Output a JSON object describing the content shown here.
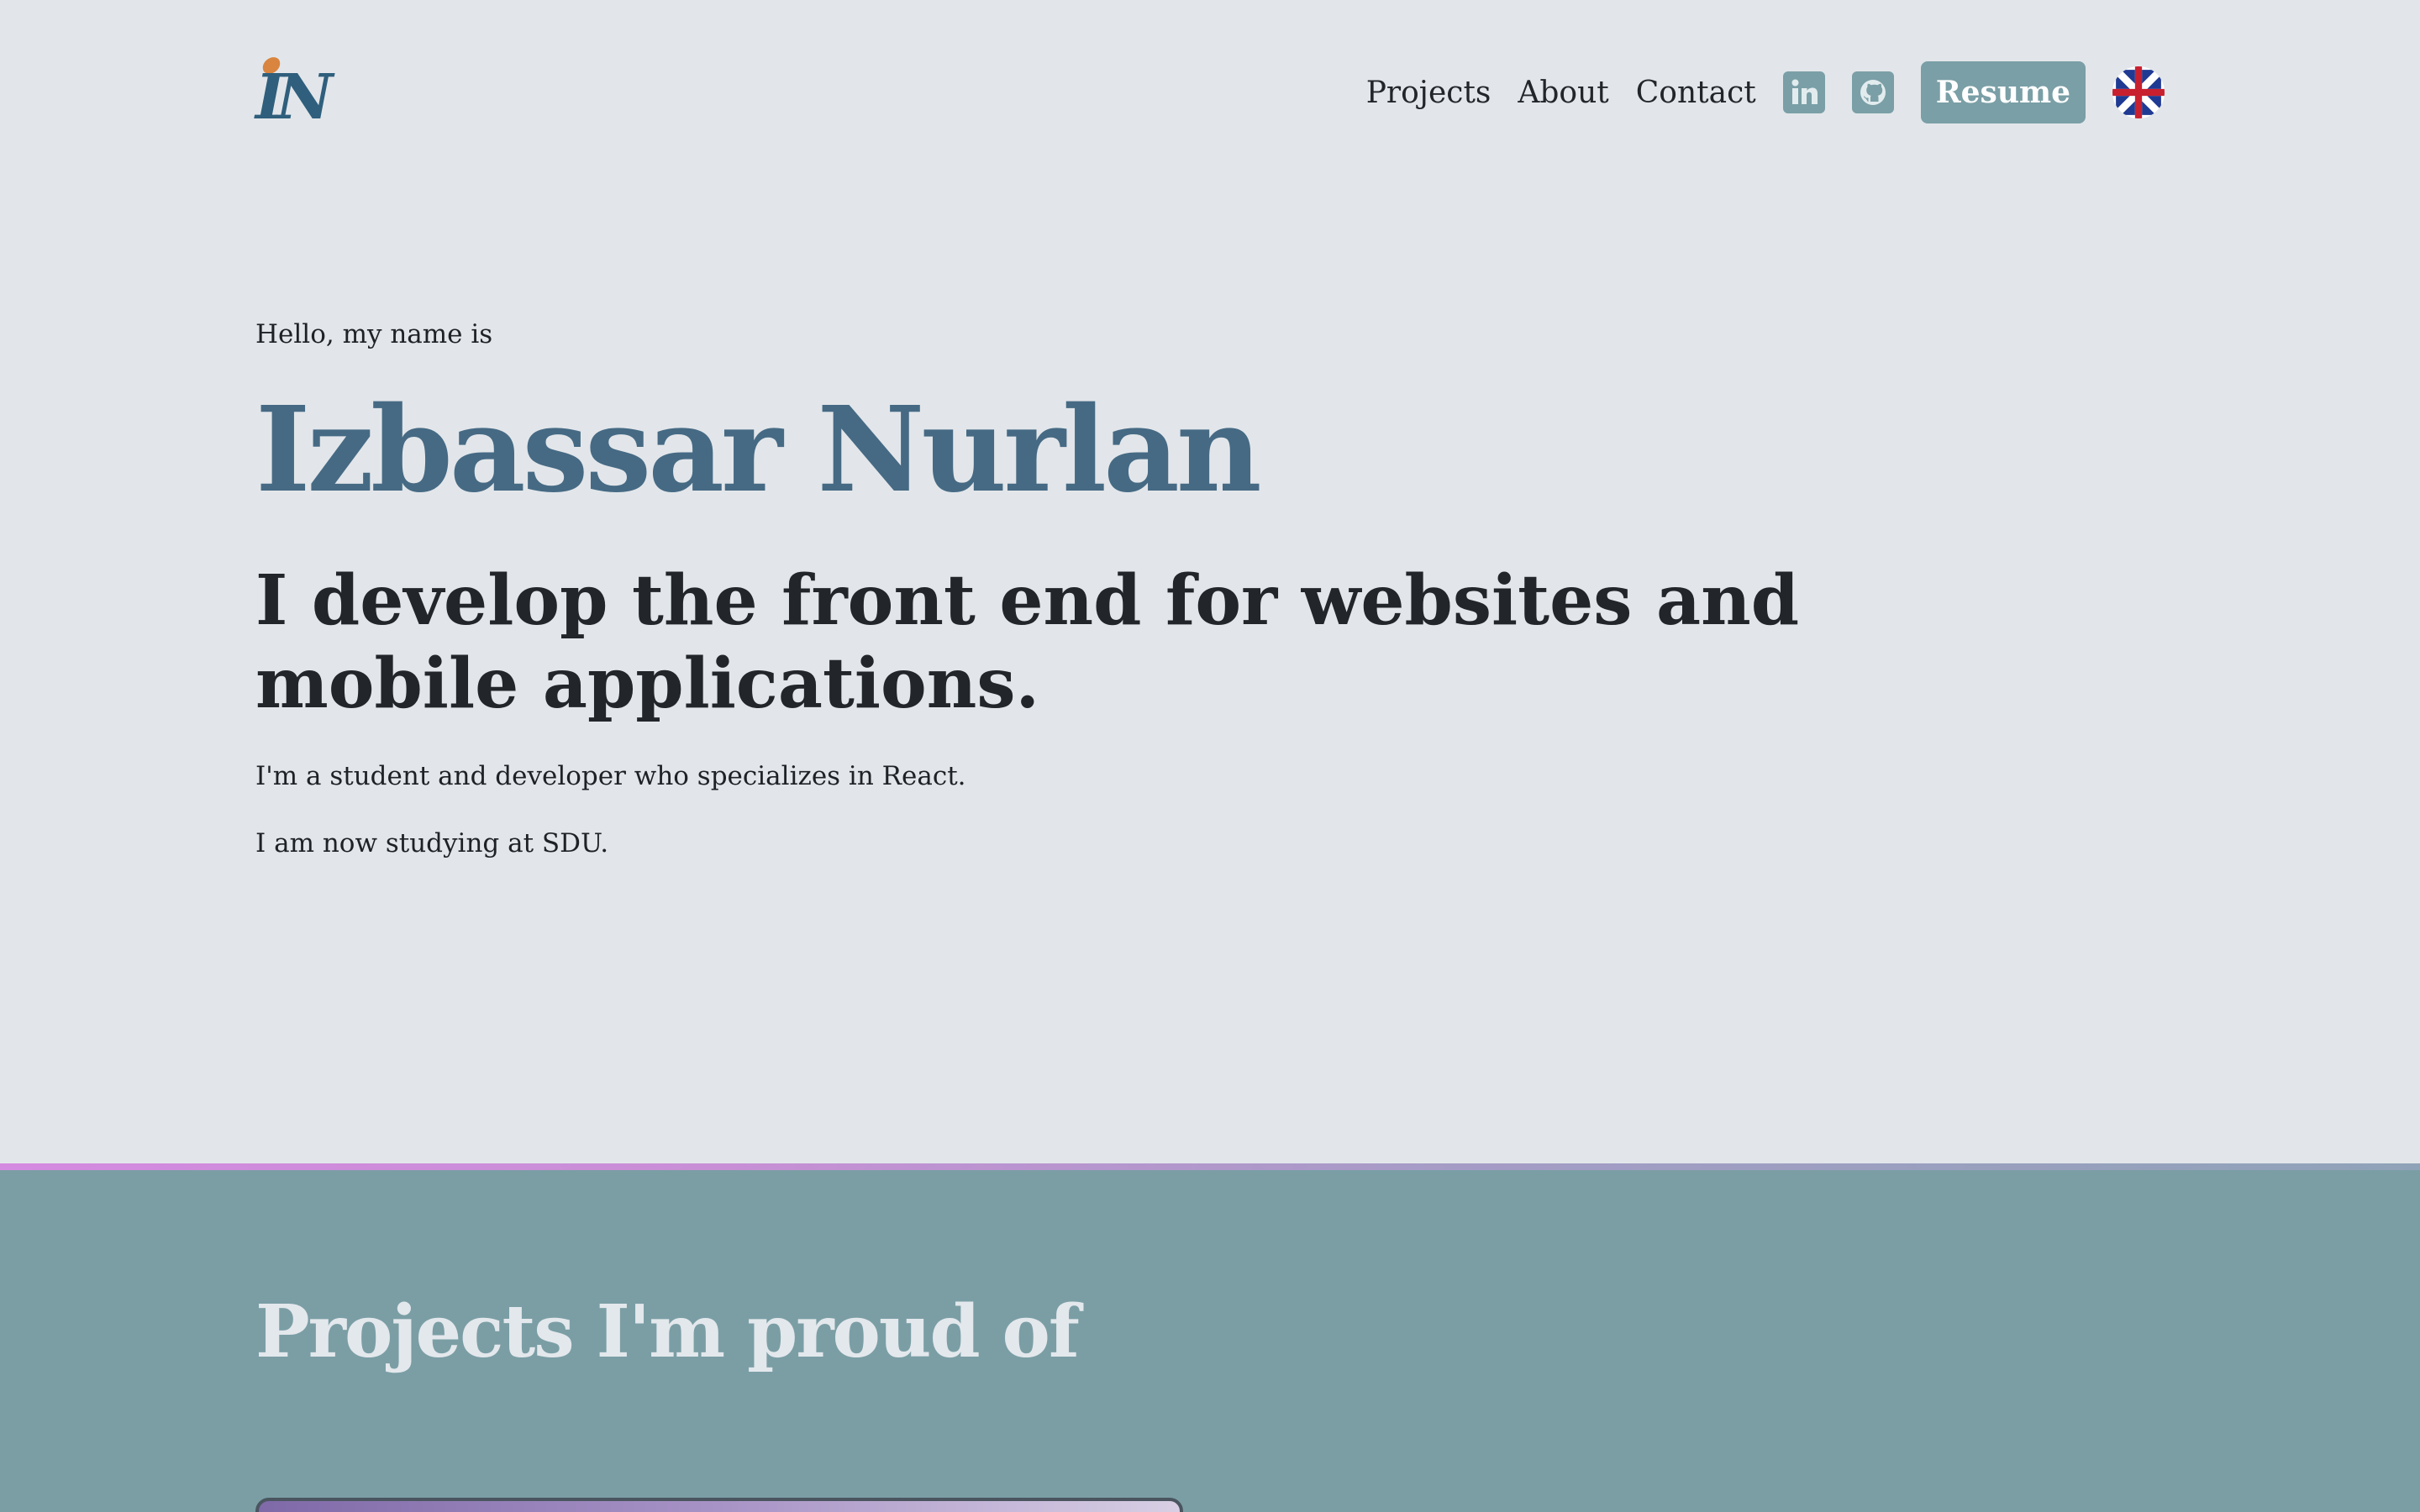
{
  "header": {
    "logo_text": "IN",
    "nav": [
      "Projects",
      "About",
      "Contact"
    ],
    "linkedin_label": "in",
    "resume_label": "Resume",
    "language_icon": "uk-flag-icon"
  },
  "hero": {
    "greeting": "Hello, my name is",
    "name": "Izbassar Nurlan",
    "tagline": "I develop the front end for websites and mobile applications.",
    "desc1": "I'm a student and developer who specializes in React.",
    "desc2": "I am now studying at SDU."
  },
  "projects": {
    "title": "Projects I'm proud of"
  },
  "colors": {
    "background": "#e2e6ea",
    "accent": "#7a9fa6",
    "name": "#466a84",
    "projects_bg": "#7b9ea5"
  }
}
